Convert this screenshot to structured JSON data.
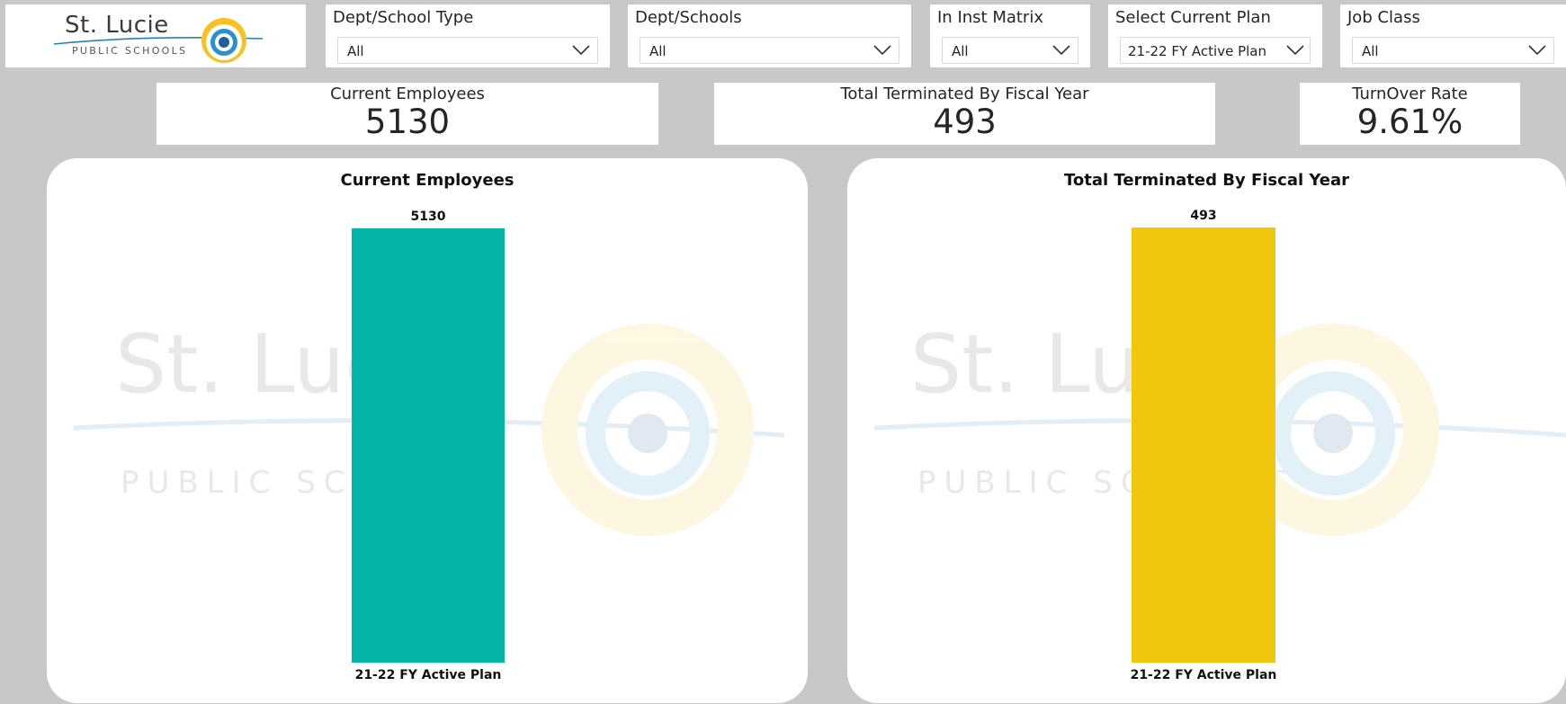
{
  "header": {
    "logo": {
      "name": "St. Lucie",
      "subtitle": "PUBLIC SCHOOLS"
    }
  },
  "filters": [
    {
      "label": "Dept/School Type",
      "value": "All"
    },
    {
      "label": "Dept/Schools",
      "value": "All"
    },
    {
      "label": "In Inst Matrix",
      "value": "All"
    },
    {
      "label": "Select Current Plan",
      "value": "21-22 FY Active Plan"
    },
    {
      "label": "Job Class",
      "value": "All"
    }
  ],
  "cards": [
    {
      "label": "Current Employees",
      "value": "5130"
    },
    {
      "label": "Total Terminated By Fiscal Year",
      "value": "493"
    },
    {
      "label": "TurnOver Rate",
      "value": "9.61%"
    }
  ],
  "colors": {
    "background": "#c8c8c8",
    "teal": "#05b5aa",
    "yellow": "#f0c60f"
  },
  "chart_data": [
    {
      "type": "bar",
      "title": "Current Employees",
      "categories": [
        "21-22 FY Active Plan"
      ],
      "values": [
        5130
      ],
      "data_labels": [
        "5130"
      ],
      "color": "#05b5aa",
      "ylim": [
        0,
        5130
      ]
    },
    {
      "type": "bar",
      "title": "Total Terminated By Fiscal Year",
      "categories": [
        "21-22 FY Active Plan"
      ],
      "values": [
        493
      ],
      "data_labels": [
        "493"
      ],
      "color": "#f0c60f",
      "ylim": [
        0,
        493
      ]
    }
  ]
}
